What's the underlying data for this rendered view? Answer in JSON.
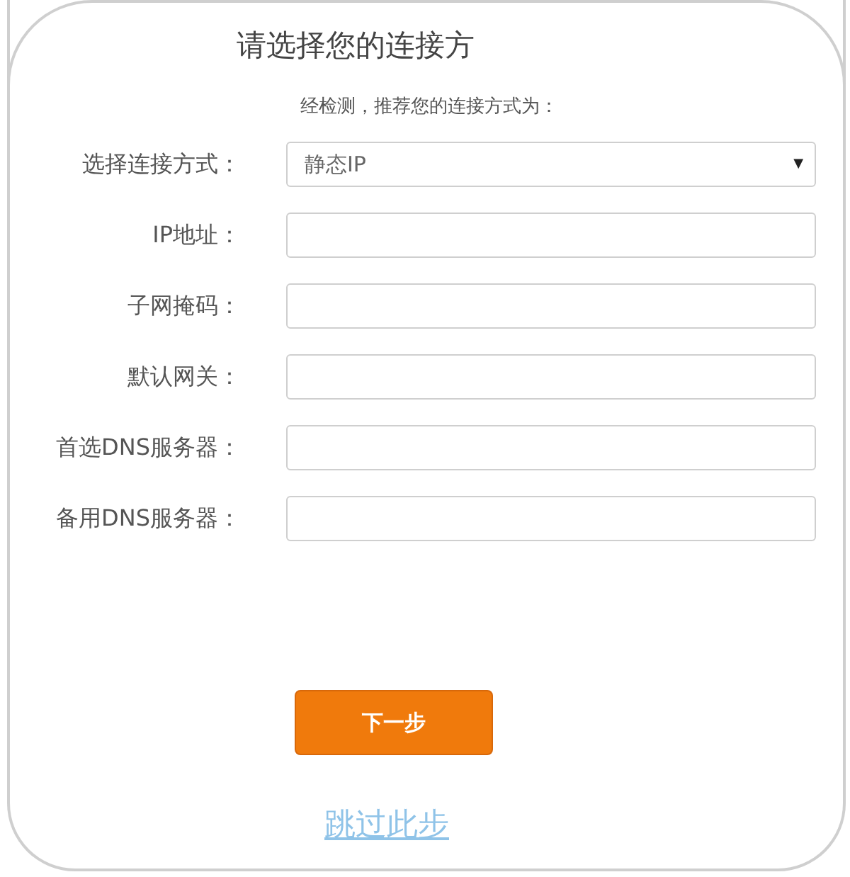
{
  "title": "请选择您的连接方",
  "subtitle": "经检测，推荐您的连接方式为：",
  "fields": [
    {
      "kind": "select",
      "label": "选择连接方式：",
      "value": "静态IP",
      "arrow": "▼"
    },
    {
      "kind": "input",
      "label": "IP地址："
    },
    {
      "kind": "input",
      "label": "子网掩码："
    },
    {
      "kind": "input",
      "label": "默认网关："
    },
    {
      "kind": "input",
      "label": "首选DNS服务器："
    },
    {
      "kind": "input",
      "label": "备用DNS服务器："
    }
  ],
  "next_button": "下一步",
  "skip_link": "跳过此步"
}
